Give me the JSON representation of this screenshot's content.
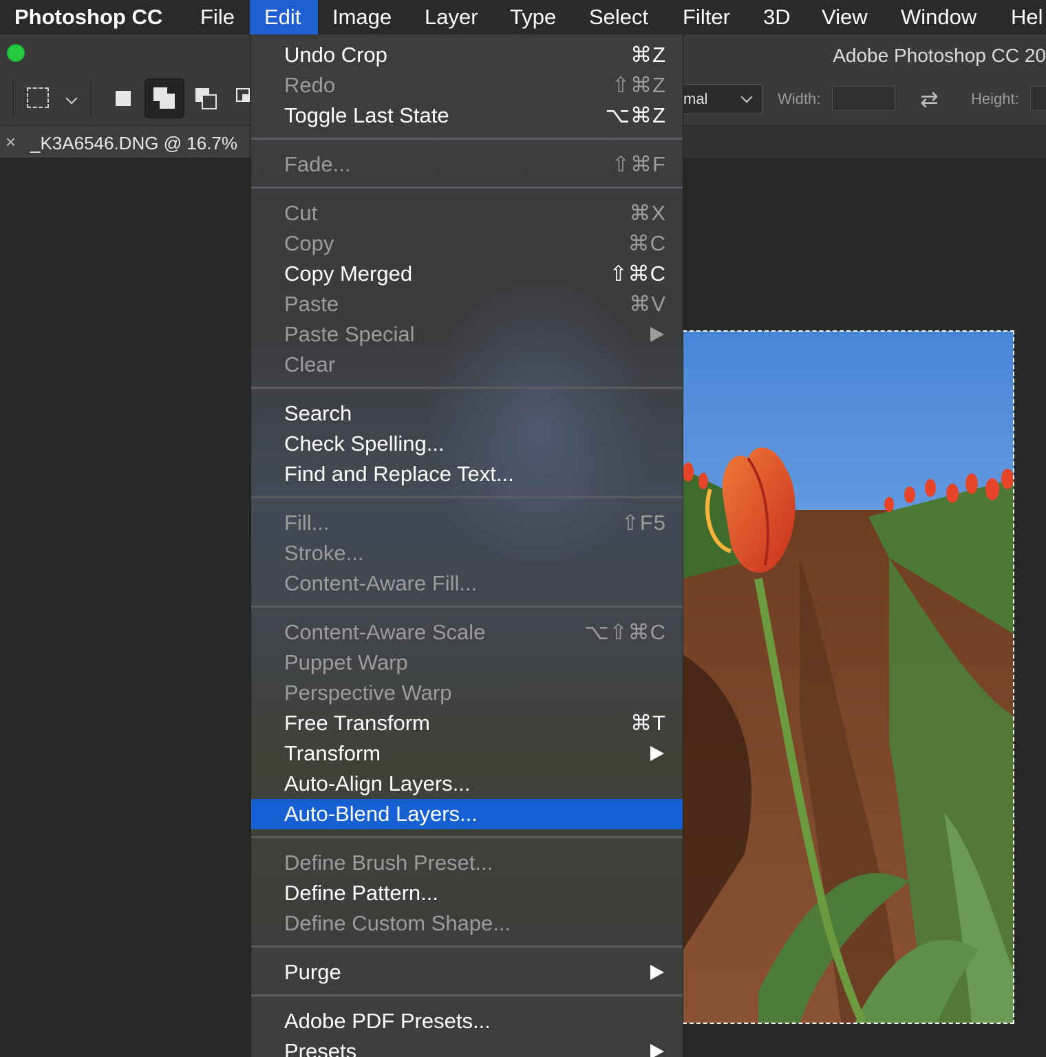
{
  "menubar": {
    "app_name": "Photoshop CC",
    "items": [
      "File",
      "Edit",
      "Image",
      "Layer",
      "Type",
      "Select",
      "Filter",
      "3D",
      "View",
      "Window",
      "Hel"
    ],
    "active_item": "Edit"
  },
  "window": {
    "title": "Adobe Photoshop CC 20"
  },
  "options_bar": {
    "style_value": "mal",
    "width_label": "Width:",
    "height_label": "Height:"
  },
  "document_tab": {
    "close": "×",
    "title": "_K3A6546.DNG @ 16.7%"
  },
  "edit_menu": {
    "groups": [
      [
        {
          "label": "Undo Crop",
          "shortcut": "⌘Z",
          "enabled": true
        },
        {
          "label": "Redo",
          "shortcut": "⇧⌘Z",
          "enabled": false
        },
        {
          "label": "Toggle Last State",
          "shortcut": "⌥⌘Z",
          "enabled": true
        }
      ],
      [
        {
          "label": "Fade...",
          "shortcut": "⇧⌘F",
          "enabled": false
        }
      ],
      [
        {
          "label": "Cut",
          "shortcut": "⌘X",
          "enabled": false
        },
        {
          "label": "Copy",
          "shortcut": "⌘C",
          "enabled": false
        },
        {
          "label": "Copy Merged",
          "shortcut": "⇧⌘C",
          "enabled": true
        },
        {
          "label": "Paste",
          "shortcut": "⌘V",
          "enabled": false
        },
        {
          "label": "Paste Special",
          "submenu": true,
          "enabled": false
        },
        {
          "label": "Clear",
          "enabled": false
        }
      ],
      [
        {
          "label": "Search",
          "enabled": true
        },
        {
          "label": "Check Spelling...",
          "enabled": true
        },
        {
          "label": "Find and Replace Text...",
          "enabled": true
        }
      ],
      [
        {
          "label": "Fill...",
          "shortcut": "⇧F5",
          "enabled": false
        },
        {
          "label": "Stroke...",
          "enabled": false
        },
        {
          "label": "Content-Aware Fill...",
          "enabled": false
        }
      ],
      [
        {
          "label": "Content-Aware Scale",
          "shortcut": "⌥⇧⌘C",
          "enabled": false
        },
        {
          "label": "Puppet Warp",
          "enabled": false
        },
        {
          "label": "Perspective Warp",
          "enabled": false
        },
        {
          "label": "Free Transform",
          "shortcut": "⌘T",
          "enabled": true
        },
        {
          "label": "Transform",
          "submenu": true,
          "enabled": true
        },
        {
          "label": "Auto-Align Layers...",
          "enabled": true
        },
        {
          "label": "Auto-Blend Layers...",
          "enabled": true,
          "highlighted": true
        }
      ],
      [
        {
          "label": "Define Brush Preset...",
          "enabled": false
        },
        {
          "label": "Define Pattern...",
          "enabled": true
        },
        {
          "label": "Define Custom Shape...",
          "enabled": false
        }
      ],
      [
        {
          "label": "Purge",
          "submenu": true,
          "enabled": true
        }
      ],
      [
        {
          "label": "Adobe PDF Presets...",
          "enabled": true
        },
        {
          "label": "Presets",
          "submenu": true,
          "enabled": true
        }
      ]
    ]
  },
  "colors": {
    "menu_highlight": "#1660d4",
    "menubar_active": "#1f5fd1",
    "traffic_green": "#27c93f"
  }
}
